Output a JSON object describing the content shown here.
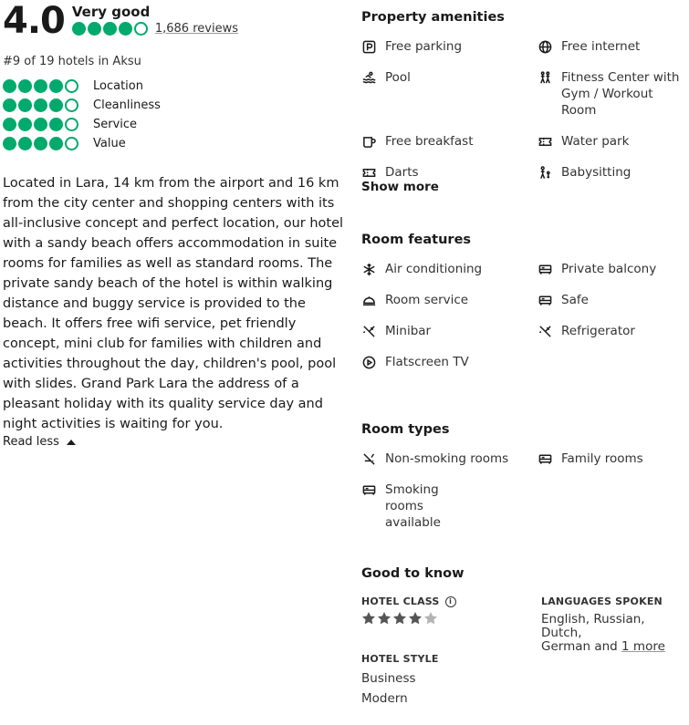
{
  "overall": {
    "score": "4.0",
    "rating_word": "Very good",
    "bubbles_full": 4,
    "reviews": "1,686 reviews",
    "rank": "#9 of 19 hotels in Aksu"
  },
  "subratings": [
    {
      "label": "Location",
      "bubbles_full": 4
    },
    {
      "label": "Cleanliness",
      "bubbles_full": 4
    },
    {
      "label": "Service",
      "bubbles_full": 4
    },
    {
      "label": "Value",
      "bubbles_full": 4
    }
  ],
  "description": "Located in Lara, 14 km from the airport and 16 km from the city center and shopping centers with its all-inclusive concept and perfect location, our hotel with a sandy beach offers accommodation in suite rooms for families as well as standard rooms. The private sandy beach of the hotel is within walking distance and buggy service is provided to the beach. It offers free wifi service, pet friendly concept, mini club for families with children and activities throughout the day, children's pool, pool with slides. Grand Park Lara the address of a pleasant holiday with its quality service day and night activities is waiting for you.",
  "read_less": "Read less",
  "amenities": {
    "title": "Property amenities",
    "items": [
      {
        "label": "Free parking",
        "icon": "parking-icon"
      },
      {
        "label": "Free internet",
        "icon": "globe-icon"
      },
      {
        "label": "Pool",
        "icon": "pool-icon"
      },
      {
        "label": "Fitness Center with Gym / Workout Room",
        "icon": "fitness-icon"
      },
      {
        "label": "Free breakfast",
        "icon": "coffee-icon"
      },
      {
        "label": "Water park",
        "icon": "ticket-icon"
      },
      {
        "label": "Darts",
        "icon": "ticket-icon"
      },
      {
        "label": "Babysitting",
        "icon": "babysitting-icon"
      }
    ],
    "show_more": "Show more"
  },
  "room_features": {
    "title": "Room features",
    "items": [
      {
        "label": "Air conditioning",
        "icon": "snowflake-icon"
      },
      {
        "label": "Private balcony",
        "icon": "bed-icon"
      },
      {
        "label": "Room service",
        "icon": "cloche-icon"
      },
      {
        "label": "Safe",
        "icon": "bed-icon"
      },
      {
        "label": "Minibar",
        "icon": "utensils-icon"
      },
      {
        "label": "Refrigerator",
        "icon": "utensils-icon"
      },
      {
        "label": "Flatscreen TV",
        "icon": "play-icon"
      }
    ]
  },
  "room_types": {
    "title": "Room types",
    "items": [
      {
        "label": "Non-smoking rooms",
        "icon": "no-smoking-icon"
      },
      {
        "label": "Family rooms",
        "icon": "bed-icon"
      },
      {
        "label": "Smoking rooms available",
        "icon": "bed-icon"
      }
    ]
  },
  "good_to_know": {
    "title": "Good to know",
    "hotel_class_label": "HOTEL CLASS",
    "hotel_class_stars": 4,
    "languages_label": "LANGUAGES SPOKEN",
    "languages_line1": "English, Russian, Dutch,",
    "languages_line2_prefix": "German and ",
    "languages_more": "1 more",
    "hotel_style_label": "HOTEL STYLE",
    "styles": [
      "Business",
      "Modern"
    ]
  },
  "colors": {
    "bubble_green": "#00aa6c",
    "star_dark": "#555555",
    "star_light": "#b3b3b3"
  }
}
